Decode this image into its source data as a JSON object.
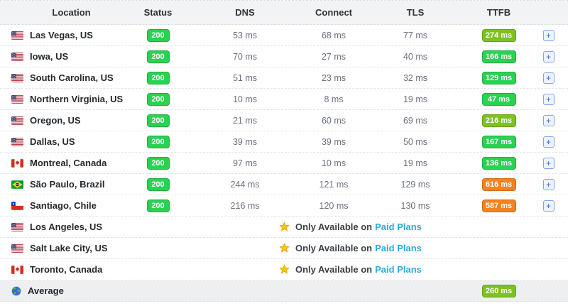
{
  "header": {
    "location": "Location",
    "status": "Status",
    "dns": "DNS",
    "connect": "Connect",
    "tls": "TLS",
    "ttfb": "TTFB"
  },
  "colors": {
    "green": "#2ad152",
    "light_green": "#7dc21f",
    "orange": "#f5821f",
    "link_blue": "#29abe2",
    "header_bg": "#f2f3f5",
    "average_bg": "#edeff1"
  },
  "icons": {
    "expand": "+"
  },
  "paid_note": {
    "prefix": "Only Available on",
    "link_label": "Paid Plans"
  },
  "rows": [
    {
      "type": "result",
      "flag_icon": "us-flag-icon",
      "location": "Las Vegas, US",
      "status": "200",
      "dns": "53 ms",
      "connect": "68 ms",
      "tls": "77 ms",
      "ttfb": "274 ms",
      "ttfb_color": "light_green"
    },
    {
      "type": "result",
      "flag_icon": "us-flag-icon",
      "location": "Iowa, US",
      "status": "200",
      "dns": "70 ms",
      "connect": "27 ms",
      "tls": "40 ms",
      "ttfb": "166 ms",
      "ttfb_color": "green"
    },
    {
      "type": "result",
      "flag_icon": "us-flag-icon",
      "location": "South Carolina, US",
      "status": "200",
      "dns": "51 ms",
      "connect": "23 ms",
      "tls": "32 ms",
      "ttfb": "129 ms",
      "ttfb_color": "green"
    },
    {
      "type": "result",
      "flag_icon": "us-flag-icon",
      "location": "Northern Virginia, US",
      "status": "200",
      "dns": "10 ms",
      "connect": "8 ms",
      "tls": "19 ms",
      "ttfb": "47 ms",
      "ttfb_color": "green"
    },
    {
      "type": "result",
      "flag_icon": "us-flag-icon",
      "location": "Oregon, US",
      "status": "200",
      "dns": "21 ms",
      "connect": "60 ms",
      "tls": "69 ms",
      "ttfb": "216 ms",
      "ttfb_color": "light_green"
    },
    {
      "type": "result",
      "flag_icon": "us-flag-icon",
      "location": "Dallas, US",
      "status": "200",
      "dns": "39 ms",
      "connect": "39 ms",
      "tls": "50 ms",
      "ttfb": "167 ms",
      "ttfb_color": "green"
    },
    {
      "type": "result",
      "flag_icon": "ca-flag-icon",
      "location": "Montreal, Canada",
      "status": "200",
      "dns": "97 ms",
      "connect": "10 ms",
      "tls": "19 ms",
      "ttfb": "136 ms",
      "ttfb_color": "green"
    },
    {
      "type": "result",
      "flag_icon": "br-flag-icon",
      "location": "São Paulo, Brazil",
      "status": "200",
      "dns": "244 ms",
      "connect": "121 ms",
      "tls": "129 ms",
      "ttfb": "616 ms",
      "ttfb_color": "orange"
    },
    {
      "type": "result",
      "flag_icon": "cl-flag-icon",
      "location": "Santiago, Chile",
      "status": "200",
      "dns": "216 ms",
      "connect": "120 ms",
      "tls": "130 ms",
      "ttfb": "587 ms",
      "ttfb_color": "orange"
    },
    {
      "type": "paid",
      "flag_icon": "us-flag-icon",
      "location": "Los Angeles, US"
    },
    {
      "type": "paid",
      "flag_icon": "us-flag-icon",
      "location": "Salt Lake City, US"
    },
    {
      "type": "paid",
      "flag_icon": "ca-flag-icon",
      "location": "Toronto, Canada"
    }
  ],
  "average": {
    "label": "Average",
    "flag_icon": "globe-icon",
    "ttfb": "260 ms",
    "ttfb_color": "light_green"
  }
}
